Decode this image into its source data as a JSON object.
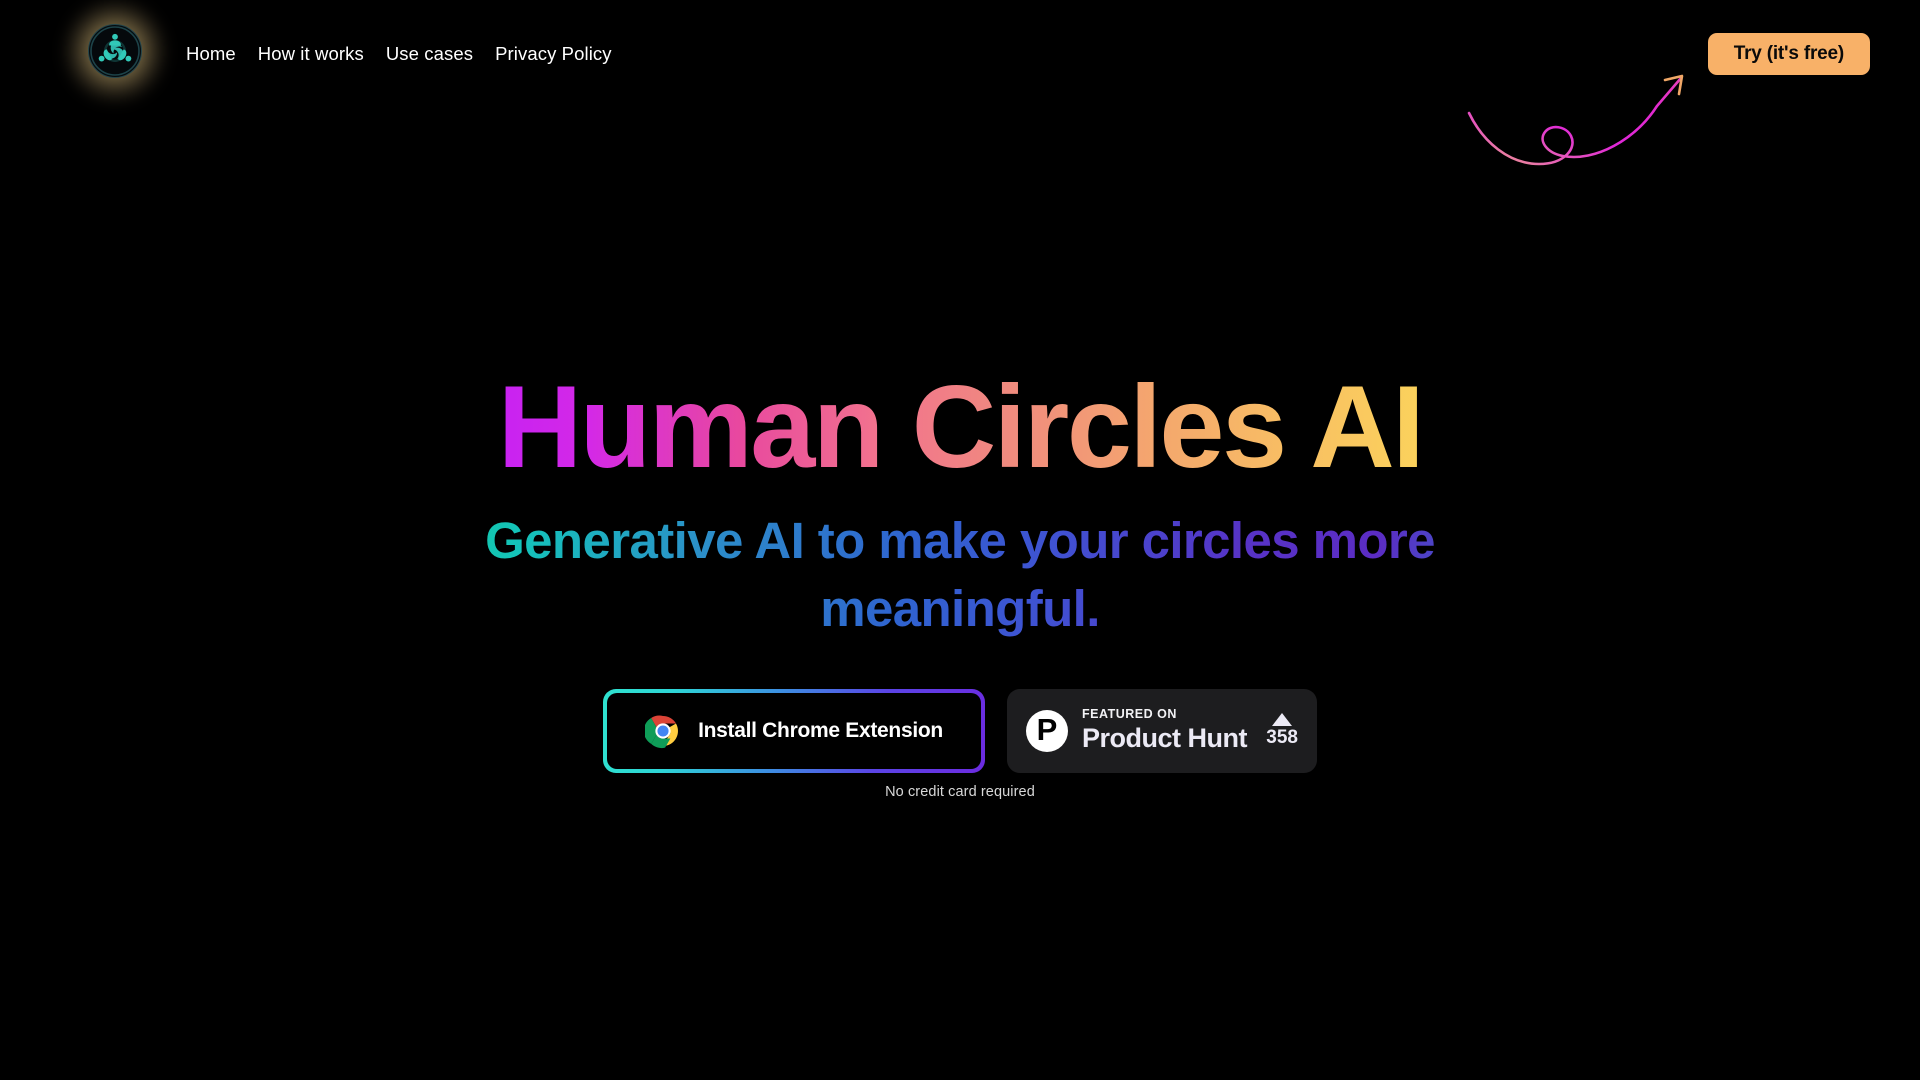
{
  "brand": {
    "logo_icon": "human-circles-logo-icon",
    "accent_teal": "#2fe2cf",
    "accent_purple": "#6c2be0",
    "accent_orange": "#f8b168",
    "background": "#000000"
  },
  "header": {
    "nav": [
      {
        "label": "Home",
        "name": "nav-link-home"
      },
      {
        "label": "How it works",
        "name": "nav-link-how-it-works"
      },
      {
        "label": "Use cases",
        "name": "nav-link-use-cases"
      },
      {
        "label": "Privacy Policy",
        "name": "nav-link-privacy-policy"
      }
    ],
    "cta": {
      "label": "Try (it's free)"
    }
  },
  "decoration": {
    "arrow_icon": "curly-arrow-icon"
  },
  "hero": {
    "title": "Human Circles AI",
    "subtitle": "Generative AI to make your circles more meaningful.",
    "chrome_button": {
      "label": "Install Chrome Extension",
      "icon": "chrome-logo-icon"
    },
    "product_hunt": {
      "featured_label": "FEATURED ON",
      "name": "Product Hunt",
      "upvote_count": "358",
      "logo_letter": "P",
      "upvote_icon": "triangle-up-icon"
    },
    "disclaimer": "No credit card required"
  }
}
